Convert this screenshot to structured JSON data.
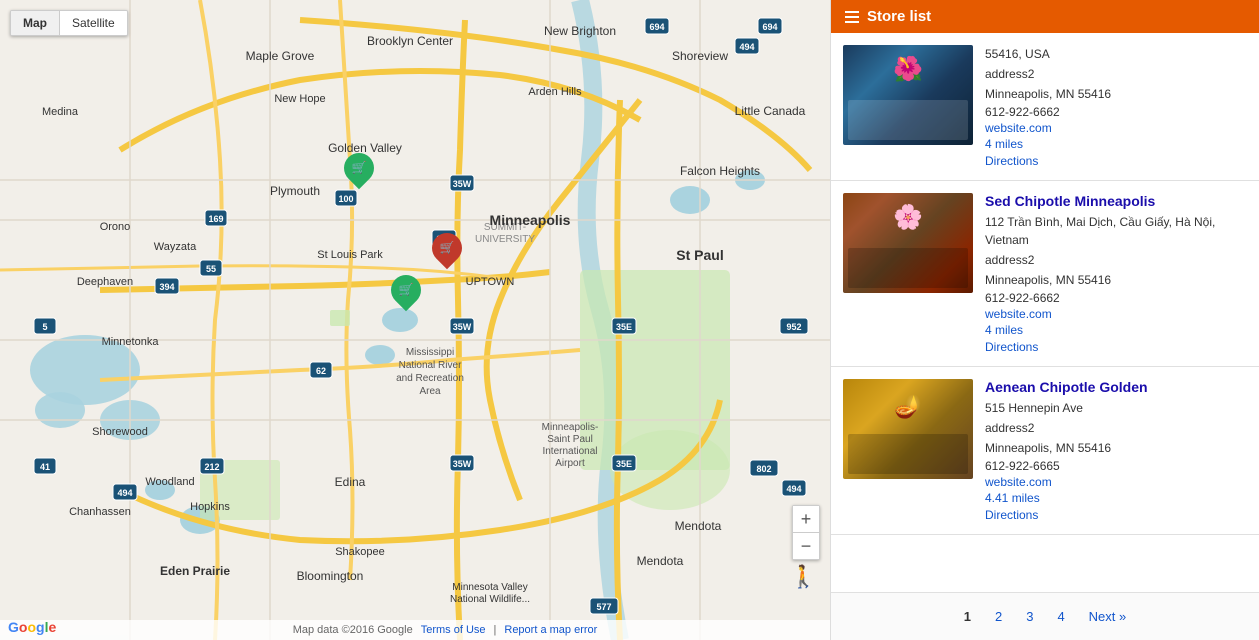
{
  "map": {
    "tab_map": "Map",
    "tab_satellite": "Satellite",
    "footer_data": "Map data ©2016 Google",
    "footer_terms": "Terms of Use",
    "footer_report": "Report a map error",
    "zoom_in": "+",
    "zoom_out": "−",
    "markers": [
      {
        "id": "marker-1",
        "type": "green",
        "top": "185",
        "left": "360",
        "icon": "🛒"
      },
      {
        "id": "marker-2",
        "type": "red",
        "top": "260",
        "left": "448",
        "icon": "🛒"
      },
      {
        "id": "marker-3",
        "type": "green",
        "top": "302",
        "left": "408",
        "icon": "🛒"
      }
    ]
  },
  "store_list": {
    "header": "Store list",
    "stores": [
      {
        "id": "store-1",
        "name": null,
        "address1": "55416, USA",
        "address2": "address2",
        "city_state": "Minneapolis, MN 55416",
        "phone": "612-922-6662",
        "website": "website.com",
        "distance": "4 miles",
        "directions": "Directions",
        "img_class": "img-1"
      },
      {
        "id": "store-2",
        "name": "Sed Chipotle Minneapolis",
        "address1": "112 Trần Bình, Mai Dịch, Cầu Giấy, Hà Nội, Vietnam",
        "address2": "address2",
        "city_state": "Minneapolis, MN 55416",
        "phone": "612-922-6662",
        "website": "website.com",
        "distance": "4 miles",
        "directions": "Directions",
        "img_class": "img-2"
      },
      {
        "id": "store-3",
        "name": "Aenean Chipotle Golden",
        "address1": "515 Hennepin Ave",
        "address2": "address2",
        "city_state": "Minneapolis, MN 55416",
        "phone": "612-922-6665",
        "website": "website.com",
        "distance": "4.41 miles",
        "directions": "Directions",
        "img_class": "img-3"
      }
    ],
    "pagination": {
      "pages": [
        "1",
        "2",
        "3",
        "4"
      ],
      "next": "Next »",
      "active": "1"
    }
  }
}
